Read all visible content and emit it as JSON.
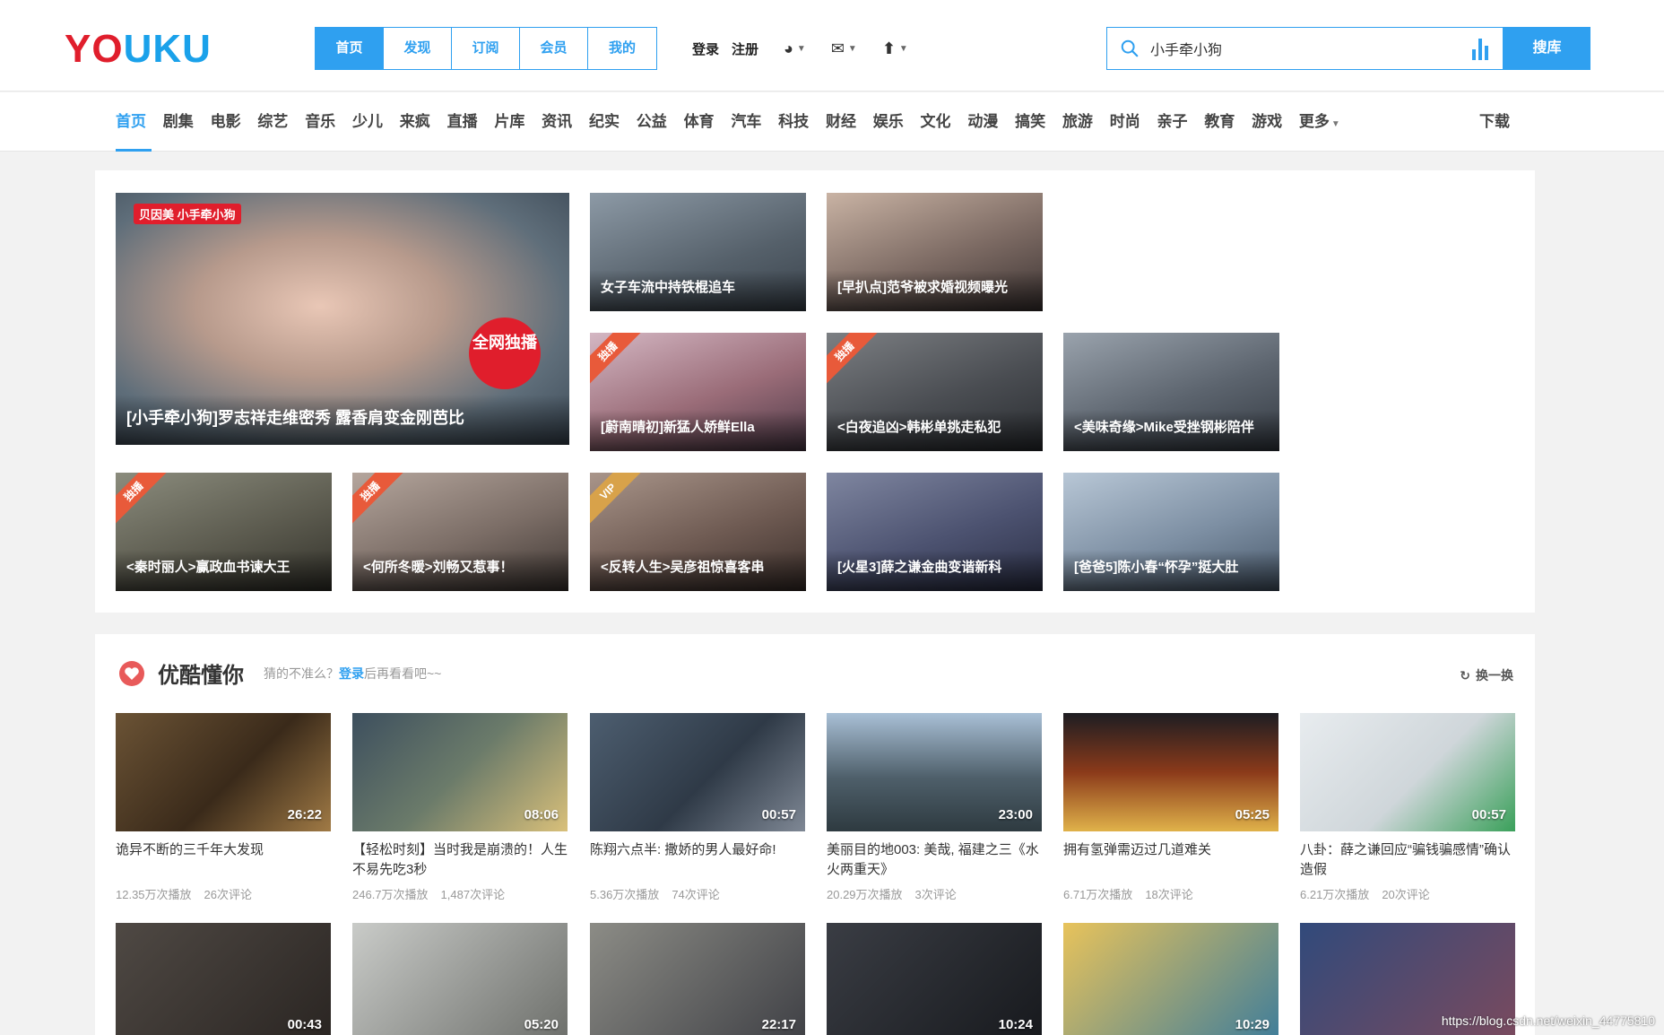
{
  "header": {
    "logo": {
      "part1": "YO",
      "part2": "U",
      "part3": "KU"
    },
    "topnav": [
      "首页",
      "发现",
      "订阅",
      "会员",
      "我的"
    ],
    "login": "登录",
    "register": "注册",
    "search": {
      "value": "小手牵小狗",
      "button": "搜库"
    }
  },
  "channelnav": {
    "items": [
      "首页",
      "剧集",
      "电影",
      "综艺",
      "音乐",
      "少儿",
      "来疯",
      "直播",
      "片库",
      "资讯",
      "纪实",
      "公益",
      "体育",
      "汽车",
      "科技",
      "财经",
      "娱乐",
      "文化",
      "动漫",
      "搞笑",
      "旅游",
      "时尚",
      "亲子",
      "教育",
      "游戏",
      "更多"
    ],
    "download": "下载"
  },
  "featured": {
    "big": {
      "caption": "[小手牵小狗]罗志祥走维密秀 露香肩变金刚芭比",
      "badge": "贝因美 小手牵小狗",
      "tag": "全网独播"
    },
    "tiles": [
      {
        "caption": "女子车流中持铁棍追车",
        "ribbon": ""
      },
      {
        "caption": "[早扒点]范爷被求婚视频曝光",
        "ribbon": ""
      },
      {
        "caption": "[蔚南晴初]新猛人娇鲜Ella",
        "ribbon": "独播"
      },
      {
        "caption": "<白夜追凶>韩彬单挑走私犯",
        "ribbon": "独播"
      },
      {
        "caption": "<美味奇缘>Mike受挫钢彬陪伴",
        "ribbon": ""
      },
      {
        "caption": "<秦时丽人>赢政血书谏大王",
        "ribbon": "独播"
      },
      {
        "caption": "<何所冬暖>刘畅又惹事！",
        "ribbon": "独播"
      },
      {
        "caption": "<反转人生>吴彦祖惊喜客串",
        "ribbon": "VIP"
      },
      {
        "caption": "[火星3]薛之谦金曲变谐新科",
        "ribbon": ""
      },
      {
        "caption": "[爸爸5]陈小春“怀孕”挺大肚",
        "ribbon": ""
      }
    ]
  },
  "recommend": {
    "title": "优酷懂你",
    "hint_pre": "猜的不准么？",
    "hint_login": "登录",
    "hint_post": "后再看看吧~~",
    "refresh": "换一换",
    "videos": [
      {
        "title": "诡异不断的三千年大发现",
        "duration": "26:22",
        "plays": "12.35万次播放",
        "comments": "26次评论"
      },
      {
        "title": "【轻松时刻】当时我是崩溃的！人生不易先吃3秒",
        "duration": "08:06",
        "plays": "246.7万次播放",
        "comments": "1,487次评论"
      },
      {
        "title": "陈翔六点半: 撒娇的男人最好命!",
        "duration": "00:57",
        "plays": "5.36万次播放",
        "comments": "74次评论"
      },
      {
        "title": "美丽目的地003: 美哉, 福建之三《水火两重天》",
        "duration": "23:00",
        "plays": "20.29万次播放",
        "comments": "3次评论"
      },
      {
        "title": "拥有氢弹需迈过几道难关",
        "duration": "05:25",
        "plays": "6.71万次播放",
        "comments": "18次评论"
      },
      {
        "title": "八卦：薛之谦回应“骗钱骗感情”确认造假",
        "duration": "00:57",
        "plays": "6.21万次播放",
        "comments": "20次评论"
      }
    ],
    "row2_durations": [
      "00:43",
      "05:20",
      "22:17",
      "10:24",
      "10:29",
      ""
    ]
  },
  "watermark": "https://blog.csdn.net/weixin_44775810"
}
